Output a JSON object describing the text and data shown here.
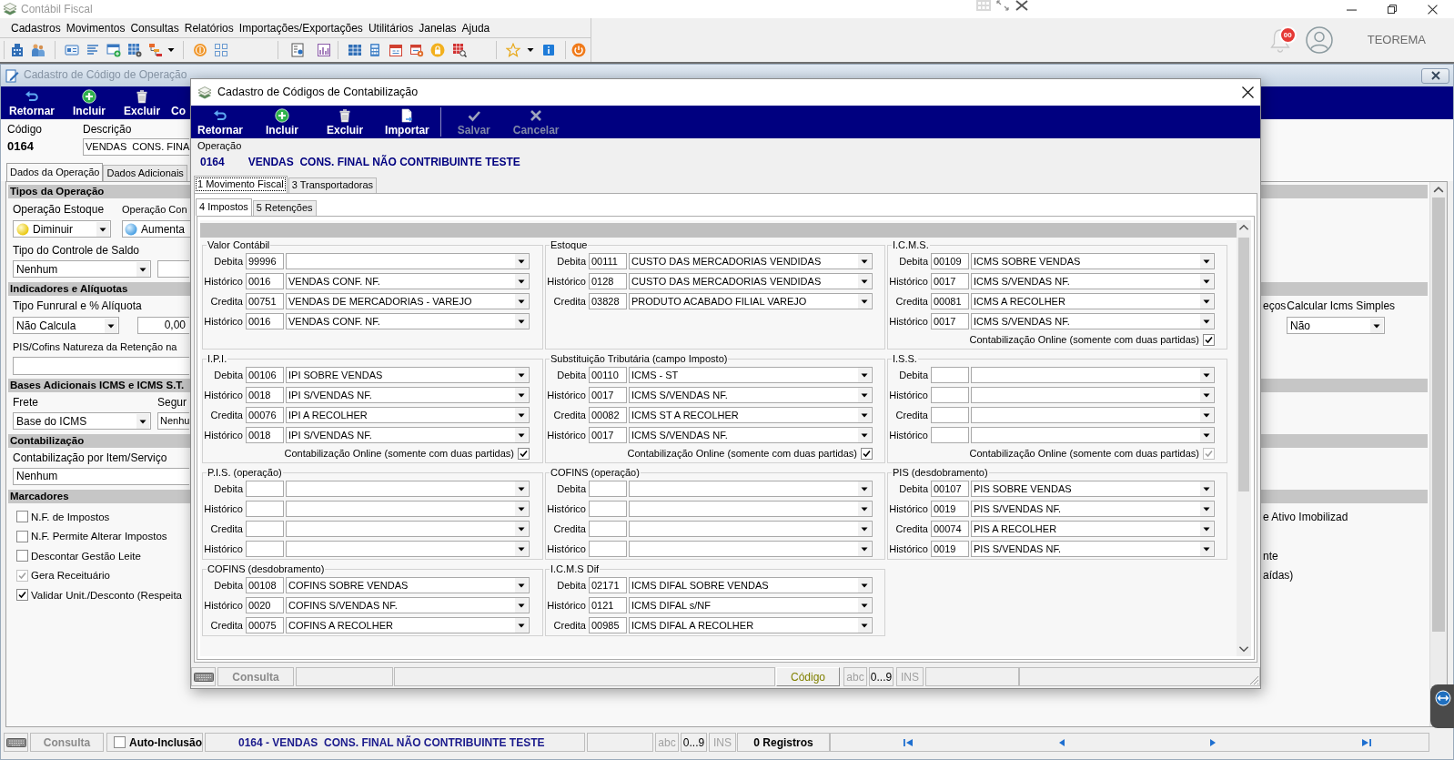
{
  "app": {
    "title": "Contábil Fiscal",
    "menu": [
      "Cadastros",
      "Movimentos",
      "Consultas",
      "Relatórios",
      "Importações/Exportações",
      "Utilitários",
      "Janelas",
      "Ajuda"
    ],
    "notification_count": "00",
    "user_name": "TEOREMA"
  },
  "operation_window": {
    "title": "Cadastro de Código de Operação",
    "toolbar": [
      "Retornar",
      "Incluir",
      "Excluir",
      "Co"
    ],
    "code": {
      "label": "Código",
      "value": "0164"
    },
    "description": {
      "label": "Descrição",
      "value": "VENDAS  CONS. FINA"
    },
    "tabs": [
      {
        "label": "Dados da Operação",
        "selected": true
      },
      {
        "label": "Dados Adicionais",
        "selected": false
      }
    ],
    "operation_types": {
      "heading": "Tipos da Operação",
      "stock": {
        "label": "Operação Estoque",
        "value": "Diminuir"
      },
      "second": {
        "label": "Operação Con",
        "value": "Aumenta"
      },
      "balance_control": {
        "label": "Tipo do Controle de Saldo",
        "value": "Nenhum"
      }
    },
    "indicators": {
      "heading": "Indicadores e Alíquotas",
      "funrural": {
        "label": "Tipo Funrural e % Alíquota",
        "value": "Não Calcula",
        "rate": "0,00"
      },
      "withholding_nature": {
        "label": "PIS/Cofins Natureza da Retenção na"
      },
      "partial_label": "eços",
      "simple_icms": {
        "label": "Calcular Icms Simples",
        "value": "Não"
      }
    },
    "additional_bases": {
      "heading": "Bases Adicionais ICMS e ICMS S.T.",
      "freight": {
        "label": "Frete",
        "value": "Base do ICMS"
      },
      "insurance": {
        "label": "Segur",
        "value": "Nenhu"
      }
    },
    "accounting": {
      "heading": "Contabilização",
      "per_item": {
        "label": "Contabilização por Item/Serviço",
        "value": "Nenhum"
      }
    },
    "markers": {
      "heading": "Marcadores",
      "items": [
        {
          "label": "N.F. de Impostos",
          "checked": false,
          "disabled": false,
          "column_2": "e Ativo Imobilizad"
        },
        {
          "label": "N.F. Permite Alterar Impostos",
          "checked": false,
          "disabled": false
        },
        {
          "label": "Descontar Gestão Leite",
          "checked": false,
          "disabled": false,
          "column_2": "nte"
        },
        {
          "label": "Gera Receituário",
          "checked": true,
          "disabled": true,
          "column_2": "aídas)"
        },
        {
          "label": "Validar Unit./Desconto (Respeita",
          "checked": true,
          "disabled": false
        }
      ]
    },
    "status_bar": {
      "mode": "Consulta",
      "auto_insert": {
        "label": "Auto-Inclusão",
        "checked": false
      },
      "record": "0164 - VENDAS  CONS. FINAL NÃO CONTRIBUINTE TESTE",
      "indicators": [
        {
          "label": "abc",
          "active": false
        },
        {
          "label": "0...9",
          "active": true
        },
        {
          "label": "INS",
          "active": false
        }
      ],
      "count": "0 Registros"
    }
  },
  "dialog": {
    "title": "Cadastro de Códigos de Contabilização",
    "toolbar": [
      {
        "label": "Retornar",
        "disabled": false
      },
      {
        "label": "Incluir",
        "disabled": false
      },
      {
        "label": "Excluir",
        "disabled": false
      },
      {
        "label": "Importar",
        "disabled": false
      },
      {
        "label": "Salvar",
        "disabled": true
      },
      {
        "label": "Cancelar",
        "disabled": true
      }
    ],
    "operation": {
      "label": "Operação",
      "code": "0164",
      "description": "VENDAS  CONS. FINAL NÃO CONTRIBUINTE TESTE"
    },
    "tabs": [
      {
        "label": "1 Movimento Fiscal",
        "selected": true
      },
      {
        "label": "3 Transportadoras",
        "selected": false
      }
    ],
    "subtabs": [
      {
        "label": "4 Impostos",
        "selected": true
      },
      {
        "label": "5 Retenções",
        "selected": false
      }
    ],
    "groups": [
      {
        "title": "Valor Contábil",
        "rows": [
          {
            "label": "Debita",
            "code": "99996"
          },
          {
            "label": "Histórico",
            "code": "0016",
            "account": "VENDAS CONF. NF."
          },
          {
            "label": "Credita",
            "code": "00751",
            "account": "VENDAS DE MERCADORIAS - VAREJO"
          },
          {
            "label": "Histórico",
            "code": "0016",
            "account": "VENDAS CONF. NF."
          }
        ]
      },
      {
        "title": "Estoque",
        "rows": [
          {
            "label": "Debita",
            "code": "00111",
            "account": "CUSTO DAS MERCADORIAS VENDIDAS"
          },
          {
            "label": "Histórico",
            "code": "0128",
            "account": "CUSTO DAS MERCADORIAS VENDIDAS"
          },
          {
            "label": "Credita",
            "code": "03828",
            "account": "PRODUTO ACABADO FILIAL VAREJO"
          }
        ]
      },
      {
        "title": "I.C.M.S.",
        "rows": [
          {
            "label": "Debita",
            "code": "00109",
            "account": "ICMS SOBRE VENDAS"
          },
          {
            "label": "Histórico",
            "code": "0017",
            "account": "ICMS S/VENDAS NF."
          },
          {
            "label": "Credita",
            "code": "00081",
            "account": "ICMS A RECOLHER"
          },
          {
            "label": "Histórico",
            "code": "0017",
            "account": "ICMS S/VENDAS NF."
          }
        ],
        "online": {
          "label": "Contabilização Online (somente com duas partidas)",
          "checked": true,
          "disabled": false
        }
      },
      {
        "title": "I.P.I.",
        "rows": [
          {
            "label": "Debita",
            "code": "00106",
            "account": "IPI SOBRE VENDAS"
          },
          {
            "label": "Histórico",
            "code": "0018",
            "account": "IPI S/VENDAS NF."
          },
          {
            "label": "Credita",
            "code": "00076",
            "account": "IPI A RECOLHER"
          },
          {
            "label": "Histórico",
            "code": "0018",
            "account": "IPI S/VENDAS NF."
          }
        ],
        "online": {
          "label": "Contabilização Online (somente com duas partidas)",
          "checked": true,
          "disabled": false
        }
      },
      {
        "title": "Substituição Tributária (campo Imposto)",
        "rows": [
          {
            "label": "Debita",
            "code": "00110",
            "account": "ICMS - ST"
          },
          {
            "label": "Histórico",
            "code": "0017",
            "account": "ICMS S/VENDAS NF."
          },
          {
            "label": "Credita",
            "code": "00082",
            "account": "ICMS ST A RECOLHER"
          },
          {
            "label": "Histórico",
            "code": "0017",
            "account": "ICMS S/VENDAS NF."
          }
        ],
        "online": {
          "label": "Contabilização Online (somente com duas partidas)",
          "checked": true,
          "disabled": false
        }
      },
      {
        "title": "I.S.S.",
        "rows": [
          {
            "label": "Debita"
          },
          {
            "label": "Histórico"
          },
          {
            "label": "Credita"
          },
          {
            "label": "Histórico"
          }
        ],
        "online": {
          "label": "Contabilização Online (somente com duas partidas)",
          "checked": true,
          "disabled": true
        }
      },
      {
        "title": "P.I.S. (operação)",
        "rows": [
          {
            "label": "Debita"
          },
          {
            "label": "Histórico"
          },
          {
            "label": "Credita"
          },
          {
            "label": "Histórico"
          }
        ]
      },
      {
        "title": "COFINS (operação)",
        "rows": [
          {
            "label": "Debita"
          },
          {
            "label": "Histórico"
          },
          {
            "label": "Credita"
          },
          {
            "label": "Histórico"
          }
        ]
      },
      {
        "title": "PIS (desdobramento)",
        "rows": [
          {
            "label": "Debita",
            "code": "00107",
            "account": "PIS SOBRE VENDAS"
          },
          {
            "label": "Histórico",
            "code": "0019",
            "account": "PIS S/VENDAS NF."
          },
          {
            "label": "Credita",
            "code": "00074",
            "account": "PIS A RECOLHER"
          },
          {
            "label": "Histórico",
            "code": "0019",
            "account": "PIS S/VENDAS NF."
          }
        ]
      },
      {
        "title": "COFINS (desdobramento)",
        "rows": [
          {
            "label": "Debita",
            "code": "00108",
            "account": "COFINS SOBRE VENDAS"
          },
          {
            "label": "Histórico",
            "code": "0020",
            "account": "COFINS S/VENDAS NF."
          },
          {
            "label": "Credita",
            "code": "00075",
            "account": "COFINS A RECOLHER"
          }
        ]
      },
      {
        "title": "I.C.M.S Dif",
        "rows": [
          {
            "label": "Debita",
            "code": "02171",
            "account": "ICMS DIFAL SOBRE VENDAS"
          },
          {
            "label": "Histórico",
            "code": "0121",
            "account": "ICMS DIFAL s/NF"
          },
          {
            "label": "Credita",
            "code": "00985",
            "account": "ICMS DIFAL A RECOLHER"
          }
        ]
      }
    ],
    "status_bar": {
      "mode": "Consulta",
      "key_field": "Código",
      "indicators": [
        {
          "label": "abc",
          "active": false
        },
        {
          "label": "0...9",
          "active": true
        },
        {
          "label": "INS",
          "active": false
        }
      ]
    }
  }
}
